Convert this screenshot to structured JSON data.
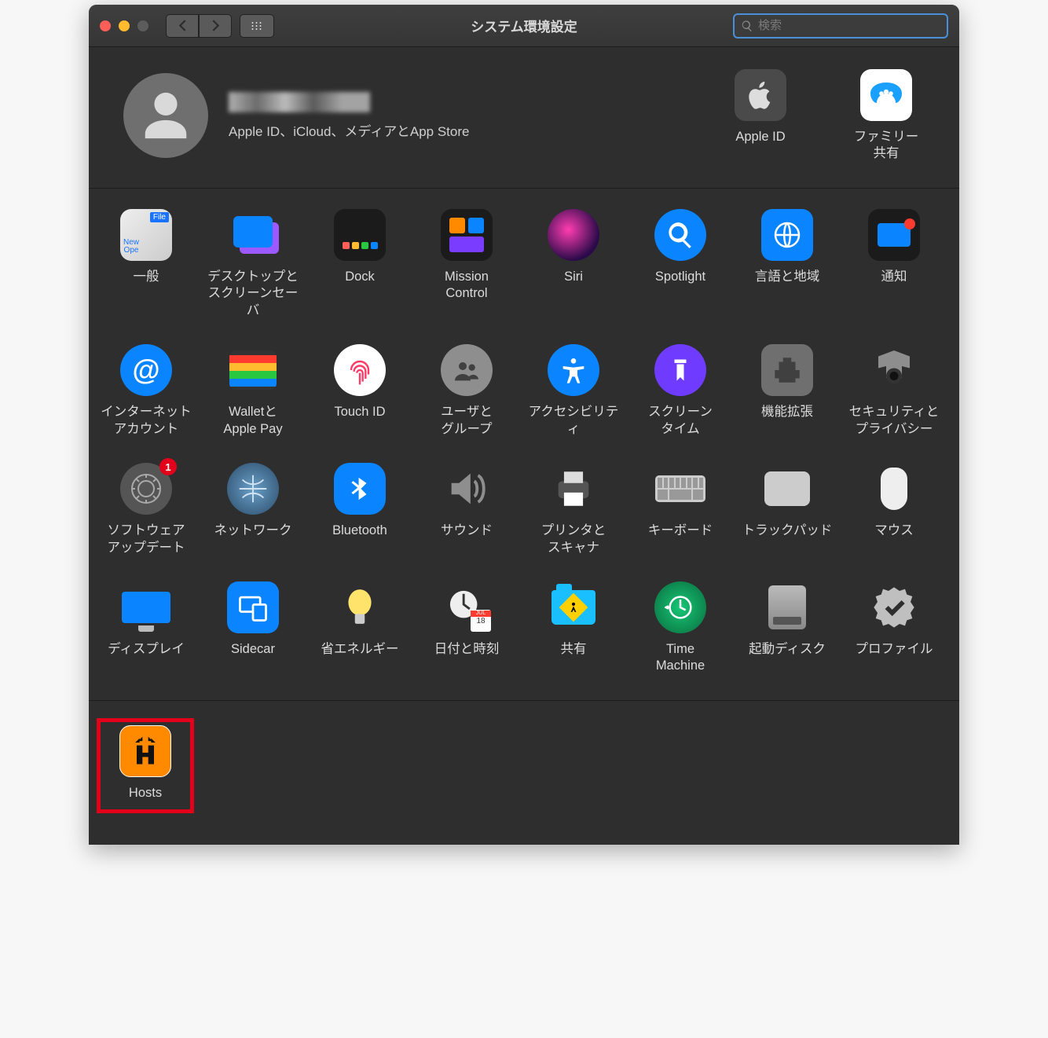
{
  "window": {
    "title": "システム環境設定"
  },
  "search": {
    "placeholder": "検索"
  },
  "user": {
    "subtitle": "Apple ID、iCloud、メディアとApp Store"
  },
  "header_items": [
    {
      "label": "Apple ID"
    },
    {
      "label": "ファミリー\n共有"
    }
  ],
  "prefs": [
    {
      "label": "一般"
    },
    {
      "label": "デスクトップと\nスクリーンセーバ"
    },
    {
      "label": "Dock"
    },
    {
      "label": "Mission\nControl"
    },
    {
      "label": "Siri"
    },
    {
      "label": "Spotlight"
    },
    {
      "label": "言語と地域"
    },
    {
      "label": "通知"
    },
    {
      "label": "インターネット\nアカウント"
    },
    {
      "label": "Walletと\nApple Pay"
    },
    {
      "label": "Touch ID"
    },
    {
      "label": "ユーザと\nグループ"
    },
    {
      "label": "アクセシビリティ"
    },
    {
      "label": "スクリーン\nタイム"
    },
    {
      "label": "機能拡張"
    },
    {
      "label": "セキュリティと\nプライバシー"
    },
    {
      "label": "ソフトウェア\nアップデート",
      "badge": "1"
    },
    {
      "label": "ネットワーク"
    },
    {
      "label": "Bluetooth"
    },
    {
      "label": "サウンド"
    },
    {
      "label": "プリンタと\nスキャナ"
    },
    {
      "label": "キーボード"
    },
    {
      "label": "トラックパッド"
    },
    {
      "label": "マウス"
    },
    {
      "label": "ディスプレイ"
    },
    {
      "label": "Sidecar"
    },
    {
      "label": "省エネルギー"
    },
    {
      "label": "日付と時刻"
    },
    {
      "label": "共有"
    },
    {
      "label": "Time\nMachine"
    },
    {
      "label": "起動ディスク"
    },
    {
      "label": "プロファイル"
    }
  ],
  "extra": [
    {
      "label": "Hosts"
    }
  ]
}
